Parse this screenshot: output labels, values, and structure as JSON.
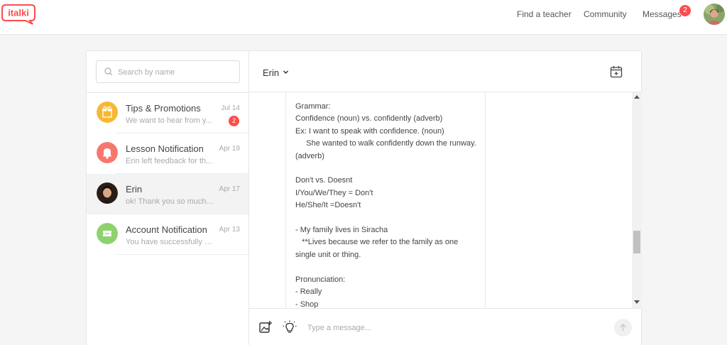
{
  "nav": {
    "logo_text": "italki",
    "find_teacher": "Find a teacher",
    "community": "Community",
    "messages": "Messages",
    "messages_badge": "2"
  },
  "search": {
    "placeholder": "Search by name"
  },
  "conversations": [
    {
      "name": "Tips & Promotions",
      "preview": "We want to hear from y...",
      "date": "Jul 14",
      "badge": "2",
      "icon": "gift-icon",
      "color": "#f7b733"
    },
    {
      "name": "Lesson Notification",
      "preview": "Erin left feedback for th...",
      "date": "Apr 19",
      "icon": "bell-icon",
      "color": "#f6786d"
    },
    {
      "name": "Erin",
      "preview": "ok! Thank you so much...",
      "date": "Apr 17",
      "icon": "avatar"
    },
    {
      "name": "Account Notification",
      "preview": "You have successfully p...",
      "date": "Apr 13",
      "icon": "ticket-icon",
      "color": "#8ed26f"
    }
  ],
  "chat": {
    "contact_name": "Erin",
    "message": "Grammar:\nConfidence (noun) vs. confidently (adverb)\nEx: I want to speak with confidence. (noun)\n     She wanted to walk confidently down the runway. (adverb)\n\nDon't vs. Doesnt\nI/You/We/They = Don't\nHe/She/It =Doesn't\n\n- My family lives in Siracha\n   **Lives because we refer to the family as one single unit or thing.\n\nPronunciation:\n- Really\n- Shop",
    "composer_placeholder": "Type a message..."
  },
  "colors": {
    "brand": "#ff4b4b",
    "badge": "#ff4b4b"
  }
}
